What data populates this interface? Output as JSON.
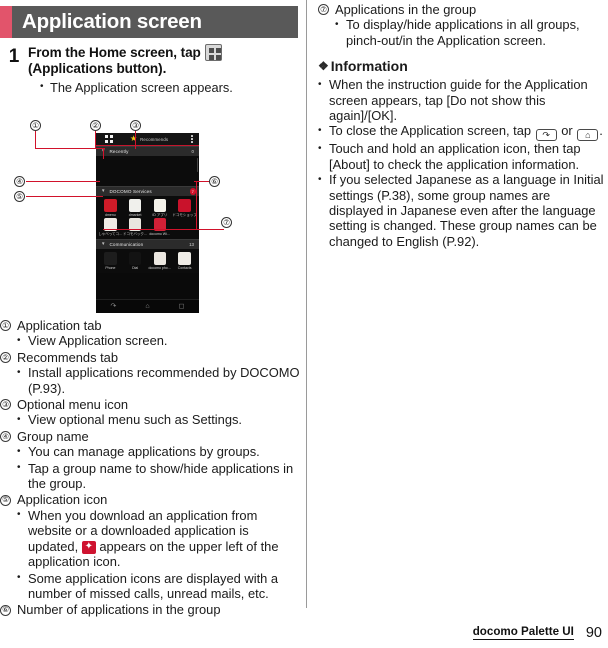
{
  "header": {
    "title": "Application screen",
    "accent_color": "#e2546b",
    "bar_color": "#595959"
  },
  "step": {
    "number": "1",
    "heading_before_icon": "From the Home screen, tap ",
    "icon_name": "applications-button-icon",
    "heading_after_icon": "(Applications button).",
    "bullets": [
      "The Application screen appears."
    ]
  },
  "figure": {
    "callouts": [
      "①",
      "②",
      "③",
      "④",
      "⑤",
      "⑥",
      "⑦"
    ],
    "phone": {
      "tabs": {
        "application_tab_icon": "grid-icon",
        "recommends_star_icon": "star-icon",
        "recommends_label": "Recommends",
        "optional_menu_icon": "overflow-menu-icon"
      },
      "groups": [
        {
          "name": "Recently",
          "count": "0",
          "badge": false,
          "apps": []
        },
        {
          "name": "DOCOMO Services",
          "count": "7",
          "badge": true,
          "apps": [
            {
              "label": "dmenu",
              "color": "#cf1b28"
            },
            {
              "label": "dmarket",
              "color": "#f0f0ec"
            },
            {
              "label": "iD アプリ",
              "color": "#f4f2ea"
            },
            {
              "label": "ドコモショップ",
              "color": "#c9122b"
            },
            {
              "label": "しゃべってコ…",
              "color": "#efeae4"
            },
            {
              "label": "ドコモバック…",
              "color": "#e9e6df"
            },
            {
              "label": "docomo Wi…",
              "color": "#d22036"
            }
          ]
        },
        {
          "name": "Communication",
          "count": "13",
          "badge": false,
          "apps": [
            {
              "label": "Phone",
              "color": "#1d1d1d"
            },
            {
              "label": "Dial",
              "color": "#131313"
            },
            {
              "label": "docomo pho…",
              "color": "#ebe7e0"
            },
            {
              "label": "Contacts",
              "color": "#efece6"
            }
          ]
        }
      ],
      "nav": {
        "back_icon": "back-icon",
        "home_icon": "home-icon",
        "recents_icon": "recents-icon"
      }
    }
  },
  "legend": [
    {
      "marker": "①",
      "title": "Application tab",
      "bullets": [
        "View Application screen."
      ]
    },
    {
      "marker": "②",
      "title": "Recommends tab",
      "bullets": [
        "Install applications recommended by DOCOMO (P.93)."
      ]
    },
    {
      "marker": "③",
      "title": "Optional menu icon",
      "bullets": [
        "View optional menu such as Settings."
      ]
    },
    {
      "marker": "④",
      "title": "Group name",
      "bullets": [
        "You can manage applications by groups.",
        "Tap a group name to show/hide applications in the group."
      ]
    },
    {
      "marker": "⑤",
      "title": "Application icon",
      "bullets": [
        "Some application icons are displayed with a number of missed calls, unread mails, etc."
      ],
      "bullet_with_badge": {
        "before": "When you download an application from website or a downloaded application is updated, ",
        "badge_icon": "update-badge-icon",
        "after": " appears on the upper left of the application icon."
      }
    },
    {
      "marker": "⑥",
      "title": "Number of applications in the group",
      "bullets": []
    }
  ],
  "right_column": {
    "item7": {
      "marker": "⑦",
      "title": "Applications in the group",
      "bullets": [
        "To display/hide applications in all groups, pinch-out/in the Application screen."
      ]
    },
    "information": {
      "glyph": "❖",
      "heading": "Information",
      "bullets": [
        "When the instruction guide for the Application screen appears, tap [Do not show this again]/[OK].",
        "Touch and hold an application icon, then tap [About] to check the application information.",
        "If you selected Japanese as a language in Initial settings (P.38), some group names are displayed in Japanese even after the language setting is changed. These group names can be changed to English (P.92)."
      ],
      "close_bullet": {
        "before": "To close the Application screen, tap ",
        "key1_icon": "back-key-icon",
        "middle": " or ",
        "key2_icon": "home-key-icon",
        "after": "."
      }
    }
  },
  "footer": {
    "section_title": "docomo Palette UI",
    "page_number": "90"
  }
}
